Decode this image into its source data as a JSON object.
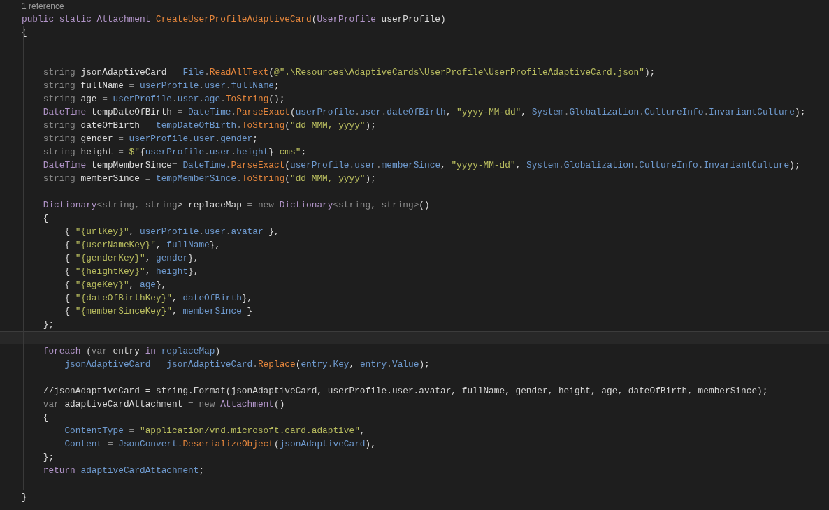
{
  "codelens": "1 reference",
  "lines": [
    {
      "current": false,
      "tokens": [
        {
          "kind": "kw",
          "text": "public static "
        },
        {
          "kind": "kw",
          "text": "Attachment "
        },
        {
          "kind": "fn",
          "text": "CreateUserProfileAdaptiveCard"
        },
        {
          "kind": "name",
          "text": "("
        },
        {
          "kind": "kw",
          "text": "UserProfile "
        },
        {
          "kind": "name",
          "text": "userProfile)"
        }
      ]
    },
    {
      "current": false,
      "tokens": [
        {
          "kind": "name",
          "text": "{"
        }
      ]
    },
    {
      "current": false
    },
    {
      "current": false
    },
    {
      "current": false,
      "tokens": [
        {
          "kind": "dim",
          "text": "    string "
        },
        {
          "kind": "name",
          "text": "jsonAdaptiveCard "
        },
        {
          "kind": "dim",
          "text": "= "
        },
        {
          "kind": "ref",
          "text": "File"
        },
        {
          "kind": "dim",
          "text": "."
        },
        {
          "kind": "fn",
          "text": "ReadAllText"
        },
        {
          "kind": "name",
          "text": "("
        },
        {
          "kind": "str",
          "text": "@\".\\Resources\\AdaptiveCards\\UserProfile\\UserProfileAdaptiveCard.json\""
        },
        {
          "kind": "name",
          "text": ");"
        }
      ]
    },
    {
      "current": false,
      "tokens": [
        {
          "kind": "dim",
          "text": "    string "
        },
        {
          "kind": "name",
          "text": "fullName "
        },
        {
          "kind": "dim",
          "text": "= "
        },
        {
          "kind": "ref",
          "text": "userProfile"
        },
        {
          "kind": "dim",
          "text": "."
        },
        {
          "kind": "ref",
          "text": "user"
        },
        {
          "kind": "dim",
          "text": "."
        },
        {
          "kind": "ref",
          "text": "fullName"
        },
        {
          "kind": "name",
          "text": ";"
        }
      ]
    },
    {
      "current": false,
      "tokens": [
        {
          "kind": "dim",
          "text": "    string "
        },
        {
          "kind": "name",
          "text": "age "
        },
        {
          "kind": "dim",
          "text": "= "
        },
        {
          "kind": "ref",
          "text": "userProfile"
        },
        {
          "kind": "dim",
          "text": "."
        },
        {
          "kind": "ref",
          "text": "user"
        },
        {
          "kind": "dim",
          "text": "."
        },
        {
          "kind": "ref",
          "text": "age"
        },
        {
          "kind": "dim",
          "text": "."
        },
        {
          "kind": "fn",
          "text": "ToString"
        },
        {
          "kind": "name",
          "text": "();"
        }
      ]
    },
    {
      "current": false,
      "tokens": [
        {
          "kind": "kw",
          "text": "    DateTime "
        },
        {
          "kind": "name",
          "text": "tempDateOfBirth "
        },
        {
          "kind": "dim",
          "text": "= "
        },
        {
          "kind": "ref",
          "text": "DateTime"
        },
        {
          "kind": "dim",
          "text": "."
        },
        {
          "kind": "fn",
          "text": "ParseExact"
        },
        {
          "kind": "name",
          "text": "("
        },
        {
          "kind": "ref",
          "text": "userProfile"
        },
        {
          "kind": "dim",
          "text": "."
        },
        {
          "kind": "ref",
          "text": "user"
        },
        {
          "kind": "dim",
          "text": "."
        },
        {
          "kind": "ref",
          "text": "dateOfBirth"
        },
        {
          "kind": "name",
          "text": ", "
        },
        {
          "kind": "str",
          "text": "\"yyyy-MM-dd\""
        },
        {
          "kind": "name",
          "text": ", "
        },
        {
          "kind": "ref",
          "text": "System"
        },
        {
          "kind": "dim",
          "text": "."
        },
        {
          "kind": "ref",
          "text": "Globalization"
        },
        {
          "kind": "dim",
          "text": "."
        },
        {
          "kind": "ref",
          "text": "CultureInfo"
        },
        {
          "kind": "dim",
          "text": "."
        },
        {
          "kind": "ref",
          "text": "InvariantCulture"
        },
        {
          "kind": "name",
          "text": ");"
        }
      ]
    },
    {
      "current": false,
      "tokens": [
        {
          "kind": "dim",
          "text": "    string "
        },
        {
          "kind": "name",
          "text": "dateOfBirth "
        },
        {
          "kind": "dim",
          "text": "= "
        },
        {
          "kind": "ref",
          "text": "tempDateOfBirth"
        },
        {
          "kind": "dim",
          "text": "."
        },
        {
          "kind": "fn",
          "text": "ToString"
        },
        {
          "kind": "name",
          "text": "("
        },
        {
          "kind": "str",
          "text": "\"dd MMM, yyyy\""
        },
        {
          "kind": "name",
          "text": ");"
        }
      ]
    },
    {
      "current": false,
      "tokens": [
        {
          "kind": "dim",
          "text": "    string "
        },
        {
          "kind": "name",
          "text": "gender "
        },
        {
          "kind": "dim",
          "text": "= "
        },
        {
          "kind": "ref",
          "text": "userProfile"
        },
        {
          "kind": "dim",
          "text": "."
        },
        {
          "kind": "ref",
          "text": "user"
        },
        {
          "kind": "dim",
          "text": "."
        },
        {
          "kind": "ref",
          "text": "gender"
        },
        {
          "kind": "name",
          "text": ";"
        }
      ]
    },
    {
      "current": false,
      "tokens": [
        {
          "kind": "dim",
          "text": "    string "
        },
        {
          "kind": "name",
          "text": "height "
        },
        {
          "kind": "dim",
          "text": "= "
        },
        {
          "kind": "str",
          "text": "$\""
        },
        {
          "kind": "name",
          "text": "{"
        },
        {
          "kind": "ref",
          "text": "userProfile"
        },
        {
          "kind": "dim",
          "text": "."
        },
        {
          "kind": "ref",
          "text": "user"
        },
        {
          "kind": "dim",
          "text": "."
        },
        {
          "kind": "ref",
          "text": "height"
        },
        {
          "kind": "name",
          "text": "}"
        },
        {
          "kind": "str",
          "text": " cms\""
        },
        {
          "kind": "name",
          "text": ";"
        }
      ]
    },
    {
      "current": false,
      "tokens": [
        {
          "kind": "kw",
          "text": "    DateTime "
        },
        {
          "kind": "name",
          "text": "tempMemberSince"
        },
        {
          "kind": "dim",
          "text": "= "
        },
        {
          "kind": "ref",
          "text": "DateTime"
        },
        {
          "kind": "dim",
          "text": "."
        },
        {
          "kind": "fn",
          "text": "ParseExact"
        },
        {
          "kind": "name",
          "text": "("
        },
        {
          "kind": "ref",
          "text": "userProfile"
        },
        {
          "kind": "dim",
          "text": "."
        },
        {
          "kind": "ref",
          "text": "user"
        },
        {
          "kind": "dim",
          "text": "."
        },
        {
          "kind": "ref",
          "text": "memberSince"
        },
        {
          "kind": "name",
          "text": ", "
        },
        {
          "kind": "str",
          "text": "\"yyyy-MM-dd\""
        },
        {
          "kind": "name",
          "text": ", "
        },
        {
          "kind": "ref",
          "text": "System"
        },
        {
          "kind": "dim",
          "text": "."
        },
        {
          "kind": "ref",
          "text": "Globalization"
        },
        {
          "kind": "dim",
          "text": "."
        },
        {
          "kind": "ref",
          "text": "CultureInfo"
        },
        {
          "kind": "dim",
          "text": "."
        },
        {
          "kind": "ref",
          "text": "InvariantCulture"
        },
        {
          "kind": "name",
          "text": ");"
        }
      ]
    },
    {
      "current": false,
      "tokens": [
        {
          "kind": "dim",
          "text": "    string "
        },
        {
          "kind": "name",
          "text": "memberSince "
        },
        {
          "kind": "dim",
          "text": "= "
        },
        {
          "kind": "ref",
          "text": "tempMemberSince"
        },
        {
          "kind": "dim",
          "text": "."
        },
        {
          "kind": "fn",
          "text": "ToString"
        },
        {
          "kind": "name",
          "text": "("
        },
        {
          "kind": "str",
          "text": "\"dd MMM, yyyy\""
        },
        {
          "kind": "name",
          "text": ");"
        }
      ]
    },
    {
      "current": false
    },
    {
      "current": false,
      "tokens": [
        {
          "kind": "kw",
          "text": "    Dictionary"
        },
        {
          "kind": "dim",
          "text": "<string, string"
        },
        {
          "kind": "name",
          "text": "> replaceMap "
        },
        {
          "kind": "dim",
          "text": "= new "
        },
        {
          "kind": "kw",
          "text": "Dictionary"
        },
        {
          "kind": "dim",
          "text": "<string, string>"
        },
        {
          "kind": "name",
          "text": "()"
        }
      ]
    },
    {
      "current": false,
      "tokens": [
        {
          "kind": "name",
          "text": "    {"
        }
      ]
    },
    {
      "current": false,
      "tokens": [
        {
          "kind": "name",
          "text": "        { "
        },
        {
          "kind": "str",
          "text": "\"{urlKey}\""
        },
        {
          "kind": "name",
          "text": ", "
        },
        {
          "kind": "ref",
          "text": "userProfile"
        },
        {
          "kind": "dim",
          "text": "."
        },
        {
          "kind": "ref",
          "text": "user"
        },
        {
          "kind": "dim",
          "text": "."
        },
        {
          "kind": "ref",
          "text": "avatar"
        },
        {
          "kind": "name",
          "text": " },"
        }
      ]
    },
    {
      "current": false,
      "tokens": [
        {
          "kind": "name",
          "text": "        { "
        },
        {
          "kind": "str",
          "text": "\"{userNameKey}\""
        },
        {
          "kind": "name",
          "text": ", "
        },
        {
          "kind": "ref",
          "text": "fullName"
        },
        {
          "kind": "name",
          "text": "},"
        }
      ]
    },
    {
      "current": false,
      "tokens": [
        {
          "kind": "name",
          "text": "        { "
        },
        {
          "kind": "str",
          "text": "\"{genderKey}\""
        },
        {
          "kind": "name",
          "text": ", "
        },
        {
          "kind": "ref",
          "text": "gender"
        },
        {
          "kind": "name",
          "text": "},"
        }
      ]
    },
    {
      "current": false,
      "tokens": [
        {
          "kind": "name",
          "text": "        { "
        },
        {
          "kind": "str",
          "text": "\"{heightKey}\""
        },
        {
          "kind": "name",
          "text": ", "
        },
        {
          "kind": "ref",
          "text": "height"
        },
        {
          "kind": "name",
          "text": "},"
        }
      ]
    },
    {
      "current": false,
      "tokens": [
        {
          "kind": "name",
          "text": "        { "
        },
        {
          "kind": "str",
          "text": "\"{ageKey}\""
        },
        {
          "kind": "name",
          "text": ", "
        },
        {
          "kind": "ref",
          "text": "age"
        },
        {
          "kind": "name",
          "text": "},"
        }
      ]
    },
    {
      "current": false,
      "tokens": [
        {
          "kind": "name",
          "text": "        { "
        },
        {
          "kind": "str",
          "text": "\"{dateOfBirthKey}\""
        },
        {
          "kind": "name",
          "text": ", "
        },
        {
          "kind": "ref",
          "text": "dateOfBirth"
        },
        {
          "kind": "name",
          "text": "},"
        }
      ]
    },
    {
      "current": false,
      "tokens": [
        {
          "kind": "name",
          "text": "        { "
        },
        {
          "kind": "str",
          "text": "\"{memberSinceKey}\""
        },
        {
          "kind": "name",
          "text": ", "
        },
        {
          "kind": "ref",
          "text": "memberSince"
        },
        {
          "kind": "name",
          "text": " }"
        }
      ]
    },
    {
      "current": false,
      "tokens": [
        {
          "kind": "name",
          "text": "    };"
        }
      ]
    },
    {
      "current": true
    },
    {
      "current": false,
      "tokens": [
        {
          "kind": "kw",
          "text": "    foreach "
        },
        {
          "kind": "name",
          "text": "("
        },
        {
          "kind": "dim",
          "text": "var "
        },
        {
          "kind": "name",
          "text": "entry "
        },
        {
          "kind": "kw",
          "text": "in "
        },
        {
          "kind": "ref",
          "text": "replaceMap"
        },
        {
          "kind": "name",
          "text": ")"
        }
      ]
    },
    {
      "current": false,
      "tokens": [
        {
          "kind": "ref",
          "text": "        jsonAdaptiveCard"
        },
        {
          "kind": "dim",
          "text": " = "
        },
        {
          "kind": "ref",
          "text": "jsonAdaptiveCard"
        },
        {
          "kind": "dim",
          "text": "."
        },
        {
          "kind": "fn",
          "text": "Replace"
        },
        {
          "kind": "name",
          "text": "("
        },
        {
          "kind": "ref",
          "text": "entry"
        },
        {
          "kind": "dim",
          "text": "."
        },
        {
          "kind": "ref",
          "text": "Key"
        },
        {
          "kind": "name",
          "text": ", "
        },
        {
          "kind": "ref",
          "text": "entry"
        },
        {
          "kind": "dim",
          "text": "."
        },
        {
          "kind": "ref",
          "text": "Value"
        },
        {
          "kind": "name",
          "text": ");"
        }
      ]
    },
    {
      "current": false
    },
    {
      "current": false,
      "tokens": [
        {
          "kind": "comment",
          "text": "    //jsonAdaptiveCard = string.Format(jsonAdaptiveCard, userProfile.user.avatar, fullName, gender, height, age, dateOfBirth, memberSince);"
        }
      ]
    },
    {
      "current": false,
      "tokens": [
        {
          "kind": "dim",
          "text": "    var "
        },
        {
          "kind": "name",
          "text": "adaptiveCardAttachment "
        },
        {
          "kind": "dim",
          "text": "= new "
        },
        {
          "kind": "kw",
          "text": "Attachment"
        },
        {
          "kind": "name",
          "text": "()"
        }
      ]
    },
    {
      "current": false,
      "tokens": [
        {
          "kind": "name",
          "text": "    {"
        }
      ]
    },
    {
      "current": false,
      "tokens": [
        {
          "kind": "ref",
          "text": "        ContentType"
        },
        {
          "kind": "dim",
          "text": " = "
        },
        {
          "kind": "str",
          "text": "\"application/vnd.microsoft.card.adaptive\""
        },
        {
          "kind": "name",
          "text": ","
        }
      ]
    },
    {
      "current": false,
      "tokens": [
        {
          "kind": "ref",
          "text": "        Content"
        },
        {
          "kind": "dim",
          "text": " = "
        },
        {
          "kind": "ref",
          "text": "JsonConvert"
        },
        {
          "kind": "dim",
          "text": "."
        },
        {
          "kind": "fn",
          "text": "DeserializeObject"
        },
        {
          "kind": "name",
          "text": "("
        },
        {
          "kind": "ref",
          "text": "jsonAdaptiveCard"
        },
        {
          "kind": "name",
          "text": "),"
        }
      ]
    },
    {
      "current": false,
      "tokens": [
        {
          "kind": "name",
          "text": "    };"
        }
      ]
    },
    {
      "current": false,
      "tokens": [
        {
          "kind": "kw",
          "text": "    return "
        },
        {
          "kind": "ref",
          "text": "adaptiveCardAttachment"
        },
        {
          "kind": "name",
          "text": ";"
        }
      ]
    },
    {
      "current": false
    },
    {
      "current": false,
      "tokens": [
        {
          "kind": "name",
          "text": "}"
        }
      ]
    }
  ]
}
